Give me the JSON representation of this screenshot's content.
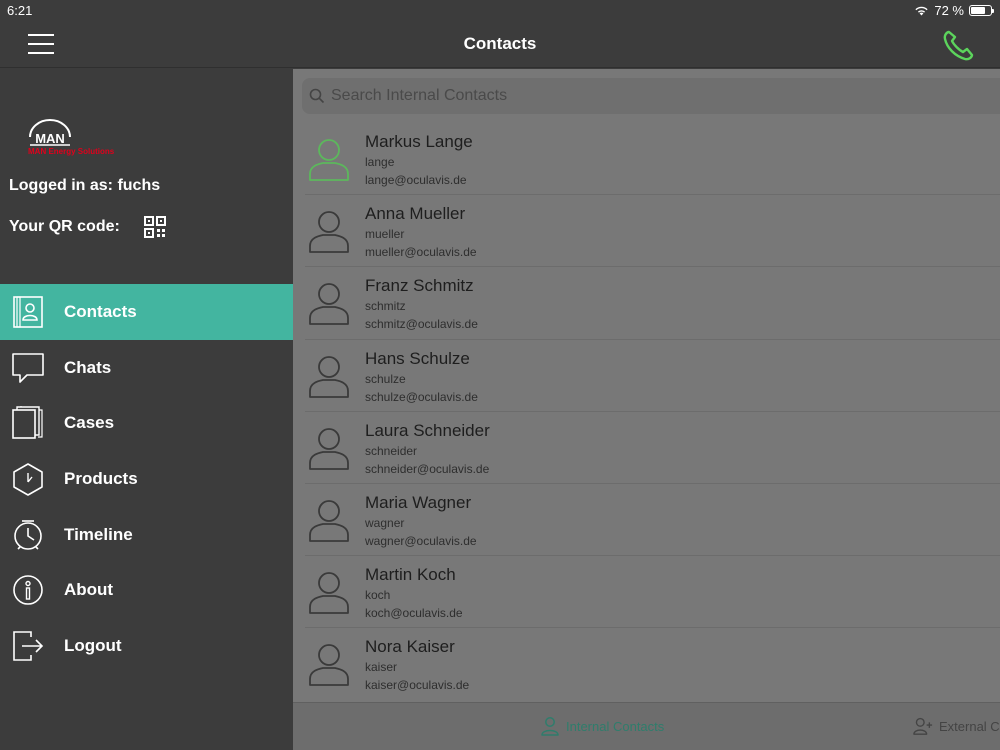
{
  "status_bar": {
    "time": "6:21",
    "battery": "72 %",
    "battery_level": 0.72
  },
  "navbar": {
    "title": "Contacts"
  },
  "colors": {
    "accent": "#43b5a0",
    "call_green": "#5cd45c",
    "brand_red": "#e0001b"
  },
  "sidebar": {
    "logo_text": "MAN",
    "logo_subtitle": "MAN Energy Solutions",
    "logged_in": "Logged in as: fuchs",
    "qr_label": "Your QR code:",
    "items": [
      {
        "label": "Contacts",
        "icon": "contacts-book-icon",
        "active": true
      },
      {
        "label": "Chats",
        "icon": "chat-bubble-icon"
      },
      {
        "label": "Cases",
        "icon": "cases-icon"
      },
      {
        "label": "Products",
        "icon": "product-hexagon-icon"
      },
      {
        "label": "Timeline",
        "icon": "clock-icon"
      },
      {
        "label": "About",
        "icon": "info-icon"
      },
      {
        "label": "Logout",
        "icon": "logout-icon"
      }
    ]
  },
  "search": {
    "placeholder": "Search Internal Contacts"
  },
  "contacts": [
    {
      "name": "Markus Lange",
      "username": "lange",
      "email": "lange@oculavis.de",
      "online": true
    },
    {
      "name": "Anna Mueller",
      "username": "mueller",
      "email": "mueller@oculavis.de"
    },
    {
      "name": "Franz Schmitz",
      "username": "schmitz",
      "email": "schmitz@oculavis.de"
    },
    {
      "name": "Hans Schulze",
      "username": "schulze",
      "email": "schulze@oculavis.de"
    },
    {
      "name": "Laura Schneider",
      "username": "schneider",
      "email": "schneider@oculavis.de"
    },
    {
      "name": "Maria Wagner",
      "username": "wagner",
      "email": "wagner@oculavis.de"
    },
    {
      "name": "Martin Koch",
      "username": "koch",
      "email": "koch@oculavis.de"
    },
    {
      "name": "Nora Kaiser",
      "username": "kaiser",
      "email": "kaiser@oculavis.de"
    }
  ],
  "tabs": {
    "internal": "Internal Contacts",
    "external": "External C"
  }
}
